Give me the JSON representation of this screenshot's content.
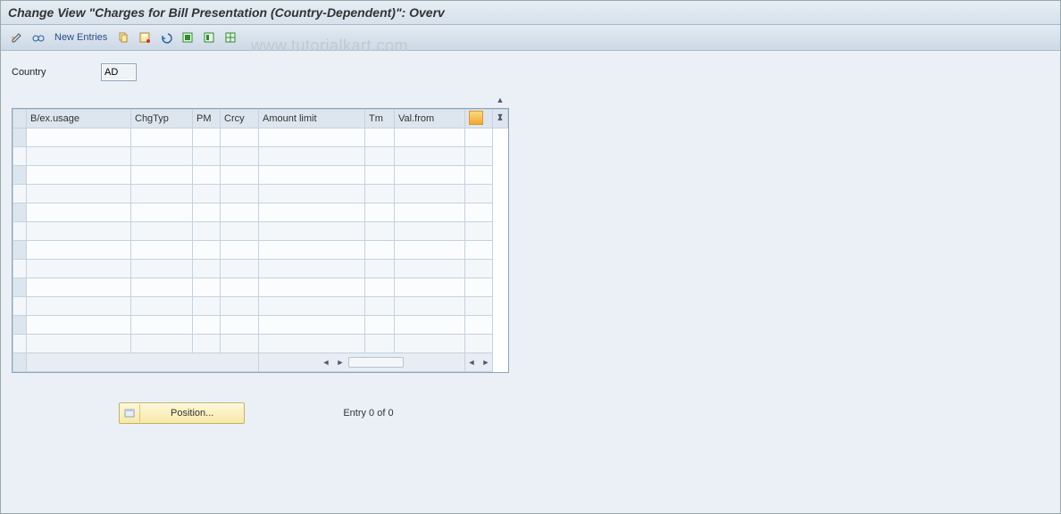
{
  "title": "Change View \"Charges for Bill Presentation (Country-Dependent)\": Overv",
  "watermark": "www.tutorialkart.com",
  "toolbar": {
    "new_entries": "New Entries"
  },
  "form": {
    "country_label": "Country",
    "country_value": "AD"
  },
  "table": {
    "columns": [
      "B/ex.usage",
      "ChgTyp",
      "PM",
      "Crcy",
      "Amount limit",
      "Tm",
      "Val.from"
    ],
    "row_count": 12
  },
  "footer": {
    "position_label": "Position...",
    "entry_text": "Entry 0 of 0"
  }
}
